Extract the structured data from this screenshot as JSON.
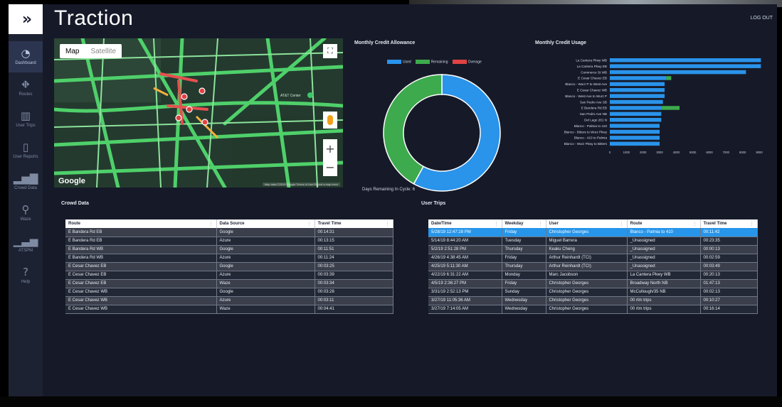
{
  "app": {
    "title": "Traction",
    "logout": "LOG OUT",
    "logo_glyph": "»"
  },
  "colors": {
    "used": "#2a93ea",
    "remaining": "#3daa4d",
    "overage": "#e04343",
    "bar": "#2a93ea",
    "bar_green": "#3daa4d",
    "selected_row": "#2795e9"
  },
  "sidebar": {
    "items": [
      {
        "label": "Dashboard",
        "icon": "dashboard-icon",
        "glyph": "◔",
        "active": true
      },
      {
        "label": "Routes",
        "icon": "routes-icon",
        "glyph": "⛖",
        "active": false
      },
      {
        "label": "User Trips",
        "icon": "map-icon",
        "glyph": "▥",
        "active": false
      },
      {
        "label": "User Reports",
        "icon": "phone-icon",
        "glyph": "▯",
        "active": false
      },
      {
        "label": "Crowd Data",
        "icon": "bar-chart-icon",
        "glyph": "▂▅▇",
        "active": false
      },
      {
        "label": "Waze",
        "icon": "pin-icon",
        "glyph": "⚲",
        "active": false
      },
      {
        "label": "ATSPM",
        "icon": "signal-icon",
        "glyph": "▁▃▅",
        "active": false
      },
      {
        "label": "Help",
        "icon": "help-icon",
        "glyph": "?",
        "active": false
      }
    ]
  },
  "map": {
    "tabs": [
      {
        "label": "Map",
        "active": true
      },
      {
        "label": "Satellite",
        "active": false
      }
    ],
    "google": "Google",
    "attribution": "Map data ©2019 Google  Terms of Use  Report a map error",
    "poi_label": "AT&T Center"
  },
  "credit_allowance": {
    "title": "Monthly Credit Allowance",
    "legend": [
      "Used",
      "Remaining",
      "Overage"
    ],
    "days_remaining": "Days Remaining In Cycle: 6"
  },
  "credit_usage": {
    "title": "Monthly Credit Usage"
  },
  "chart_data": [
    {
      "type": "pie",
      "title": "Monthly Credit Allowance",
      "categories": [
        "Used",
        "Remaining",
        "Overage"
      ],
      "values": [
        58,
        42,
        0
      ],
      "donut": true,
      "legend": "top"
    },
    {
      "type": "bar",
      "orientation": "horizontal",
      "title": "Monthly Credit Usage",
      "categories": [
        "La Cantera Pkwy WB",
        "La Cantera Pkwy EB",
        "Commerce St WB",
        "E Cesar Chavez EB",
        "Blanco - Wurz P to West Ave",
        "E Cesar Chavez WB",
        "Blanco - West Ave to Wurz P",
        "San Pedro Ave SB",
        "E Bandera Rd EB",
        "San Pedro Ave NB",
        "Del Lago 281 N",
        "Blanco - Palmia to 410",
        "Blanco - Bitters to Wurz Pkwy",
        "Blanco - 410 to Palmia",
        "Blanco - Wurz Pkwy to Bitters"
      ],
      "series": [
        {
          "values": [
            9100,
            9100,
            8200,
            3400,
            3300,
            3300,
            3300,
            3200,
            3100,
            3100,
            3100,
            3000,
            3000,
            3000,
            3000
          ]
        },
        {
          "values": [
            0,
            0,
            0,
            300,
            0,
            0,
            0,
            0,
            1100,
            0,
            0,
            0,
            0,
            0,
            0
          ]
        }
      ],
      "xticks": [
        "0",
        "1000",
        "2000",
        "3000",
        "4000",
        "5000",
        "6000",
        "7000",
        "8000",
        "9000"
      ],
      "xlim": [
        0,
        9000
      ]
    }
  ],
  "crowd": {
    "title": "Crowd Data",
    "headers": [
      "Route",
      "Data Source",
      "Travel Time"
    ],
    "rows": [
      [
        "E Bandera Rd EB",
        "Google",
        "00:14:31"
      ],
      [
        "E Bandera Rd EB",
        "Azure",
        "00:13:15"
      ],
      [
        "E Bandera Rd WB",
        "Google",
        "00:11:51"
      ],
      [
        "E Bandera Rd WB",
        "Azure",
        "00:11:24"
      ],
      [
        "E Cesar Chavez EB",
        "Google",
        "00:03:25"
      ],
      [
        "E Cesar Chavez EB",
        "Azure",
        "00:03:39"
      ],
      [
        "E Cesar Chavez EB",
        "Waze",
        "00:03:34"
      ],
      [
        "E Cesar Chavez WB",
        "Google",
        "00:03:28"
      ],
      [
        "E Cesar Chavez WB",
        "Azure",
        "00:03:11"
      ],
      [
        "E Cesar Chavez WB",
        "Waze",
        "00:04:41"
      ]
    ]
  },
  "trips": {
    "title": "User Trips",
    "headers": [
      "Date/Time",
      "Weekday",
      "User",
      "Route",
      "Travel Time"
    ],
    "rows": [
      [
        "5/28/19 12:47:28 PM",
        "Friday",
        "Christopher Georges",
        "Blanco - Palmia to 410",
        "00:11:42"
      ],
      [
        "5/14/19 8:44:20 AM",
        "Tuesday",
        "Miguel Barrera",
        "_Unassigned",
        "00:23:35"
      ],
      [
        "5/2/19 2:51:28 PM",
        "Thursday",
        "Keaku Cheng",
        "_Unassigned",
        "00:00:13"
      ],
      [
        "4/26/19 4:38:45 AM",
        "Friday",
        "Arthur Reinhardt (TCI)",
        "_Unassigned",
        "00:02:59"
      ],
      [
        "4/25/19 5:11:30 AM",
        "Thursday",
        "Arthur Reinhardt (TCI)",
        "_Unassigned",
        "00:03:49"
      ],
      [
        "4/22/19 6:31:22 AM",
        "Monday",
        "Marc Jacobson",
        "La Cantera Pkwy WB",
        "00:20:13"
      ],
      [
        "4/5/19 2:36:27 PM",
        "Friday",
        "Christopher Georges",
        "Broadway North NB",
        "01:47:13"
      ],
      [
        "3/31/19 2:52:13 PM",
        "Sunday",
        "Christopher Georges",
        "McCullough/35 NB",
        "00:02:13"
      ],
      [
        "3/27/19 11:05:36 AM",
        "Wednesday",
        "Christopher Georges",
        "00 rtm trips",
        "00:10:27"
      ],
      [
        "3/27/19 7:14:05 AM",
        "Wednesday",
        "Christopher Georges",
        "00 rtm trips",
        "00:16:14"
      ]
    ]
  }
}
